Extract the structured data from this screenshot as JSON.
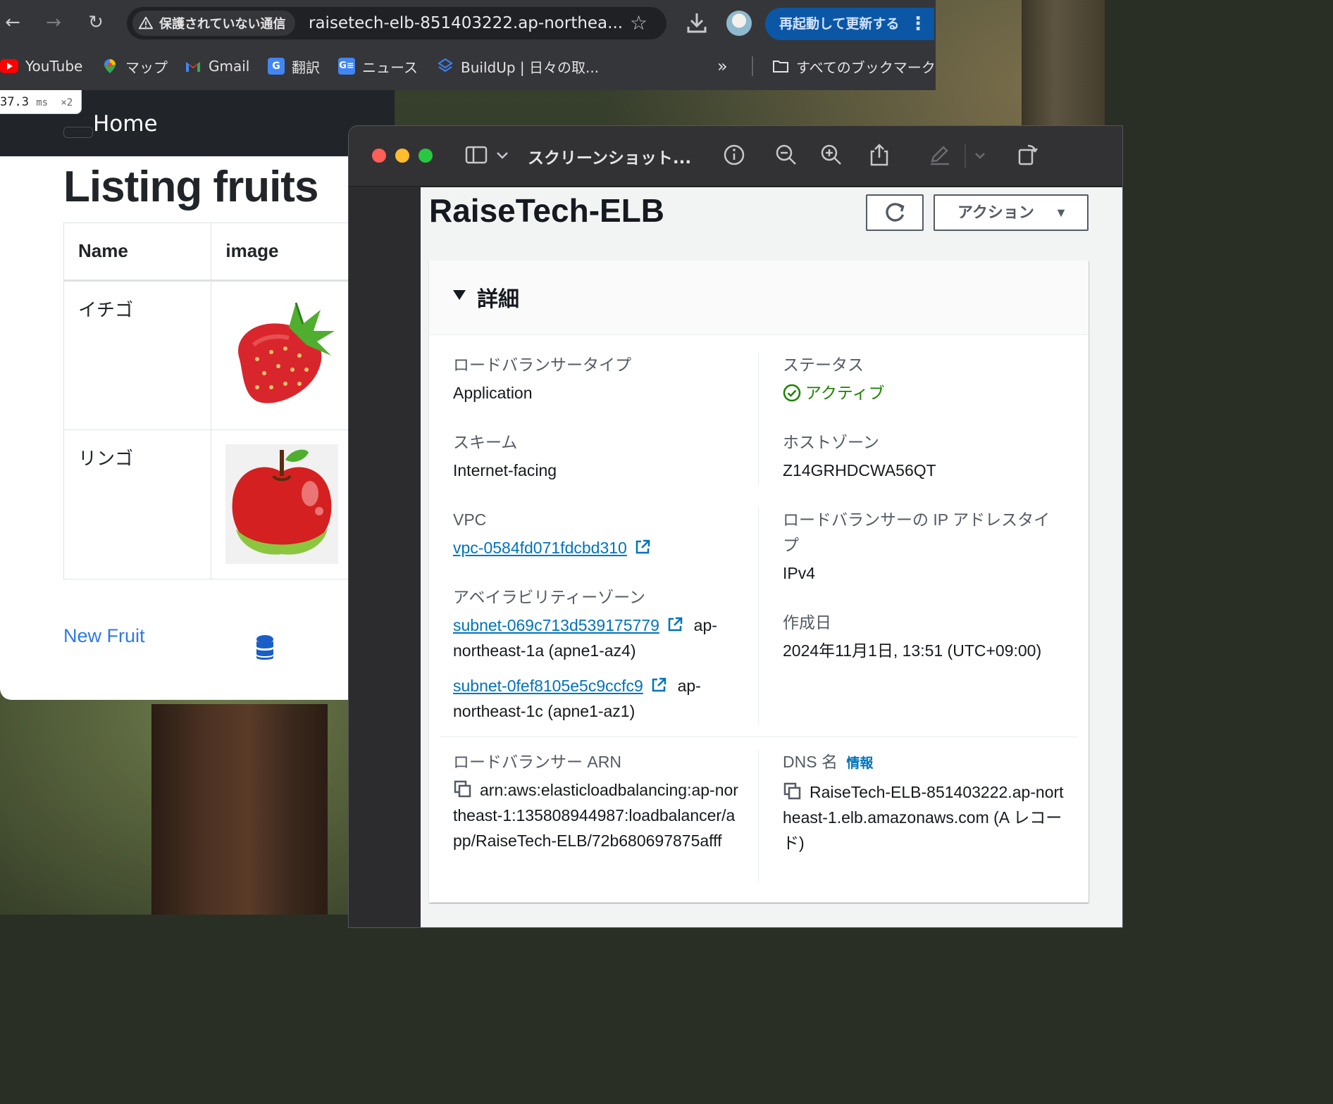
{
  "browser": {
    "insecure_label": "保護されていない通信",
    "url": "raisetech-elb-851403222.ap-northea...",
    "relaunch_label": "再起動して更新する",
    "bookmarks": [
      {
        "label": "YouTube",
        "icon": "youtube-icon",
        "color": "#ff0000"
      },
      {
        "label": "マップ",
        "icon": "maps-icon",
        "color": "#34a853"
      },
      {
        "label": "Gmail",
        "icon": "gmail-icon",
        "color": "#ea4335"
      },
      {
        "label": "翻訳",
        "icon": "translate-icon",
        "color": "#4285f4"
      },
      {
        "label": "ニュース",
        "icon": "news-icon",
        "color": "#4285f4"
      },
      {
        "label": "BuildUp | 日々の取...",
        "icon": "buildup-icon",
        "color": "#3b82f6"
      }
    ],
    "more_bookmarks": "»",
    "all_bookmarks_label": "すべてのブックマーク"
  },
  "webpage": {
    "perf_value": "37.3",
    "perf_unit": "ms",
    "perf_mult": "×2",
    "nav_home": "Home",
    "title": "Listing fruits",
    "table": {
      "headers": [
        "Name",
        "image"
      ],
      "rows": [
        {
          "name": "イチゴ",
          "image": "strawberry"
        },
        {
          "name": "リンゴ",
          "image": "apple"
        }
      ]
    },
    "new_link": "New Fruit"
  },
  "preview": {
    "title": "スクリーンショット...",
    "elb": {
      "name": "RaiseTech-ELB",
      "action_label": "アクション",
      "section_title": "詳細",
      "lb_type_label": "ロードバランサータイプ",
      "lb_type_value": "Application",
      "status_label": "ステータス",
      "status_value": "アクティブ",
      "scheme_label": "スキーム",
      "scheme_value": "Internet-facing",
      "hosted_zone_label": "ホストゾーン",
      "hosted_zone_value": "Z14GRHDCWA56QT",
      "vpc_label": "VPC",
      "vpc_value": "vpc-0584fd071fdcbd310",
      "ip_type_label": "ロードバランサーの IP アドレスタイプ",
      "ip_type_value": "IPv4",
      "az_label": "アベイラビリティーゾーン",
      "subnets": [
        {
          "id": "subnet-069c713d539175779",
          "zone": "ap-northeast-1a (apne1-az4)"
        },
        {
          "id": "subnet-0fef8105e5c9ccfc9",
          "zone": "ap-northeast-1c (apne1-az1)"
        }
      ],
      "created_label": "作成日",
      "created_value": "2024年11月1日, 13:51 (UTC+09:00)",
      "arn_label": "ロードバランサー ARN",
      "arn_value": "arn:aws:elasticloadbalancing:ap-northeast-1:135808944987:loadbalancer/app/RaiseTech-ELB/72b680697875afff",
      "dns_label": "DNS 名",
      "dns_info": "情報",
      "dns_value": "RaiseTech-ELB-851403222.ap-northeast-1.elb.amazonaws.com (A レコード)"
    }
  },
  "colors": {
    "aws_link": "#0073bb",
    "aws_status_ok": "#1d8102",
    "chrome_accent": "#0b57a6",
    "web_link": "#2f7ae5"
  }
}
